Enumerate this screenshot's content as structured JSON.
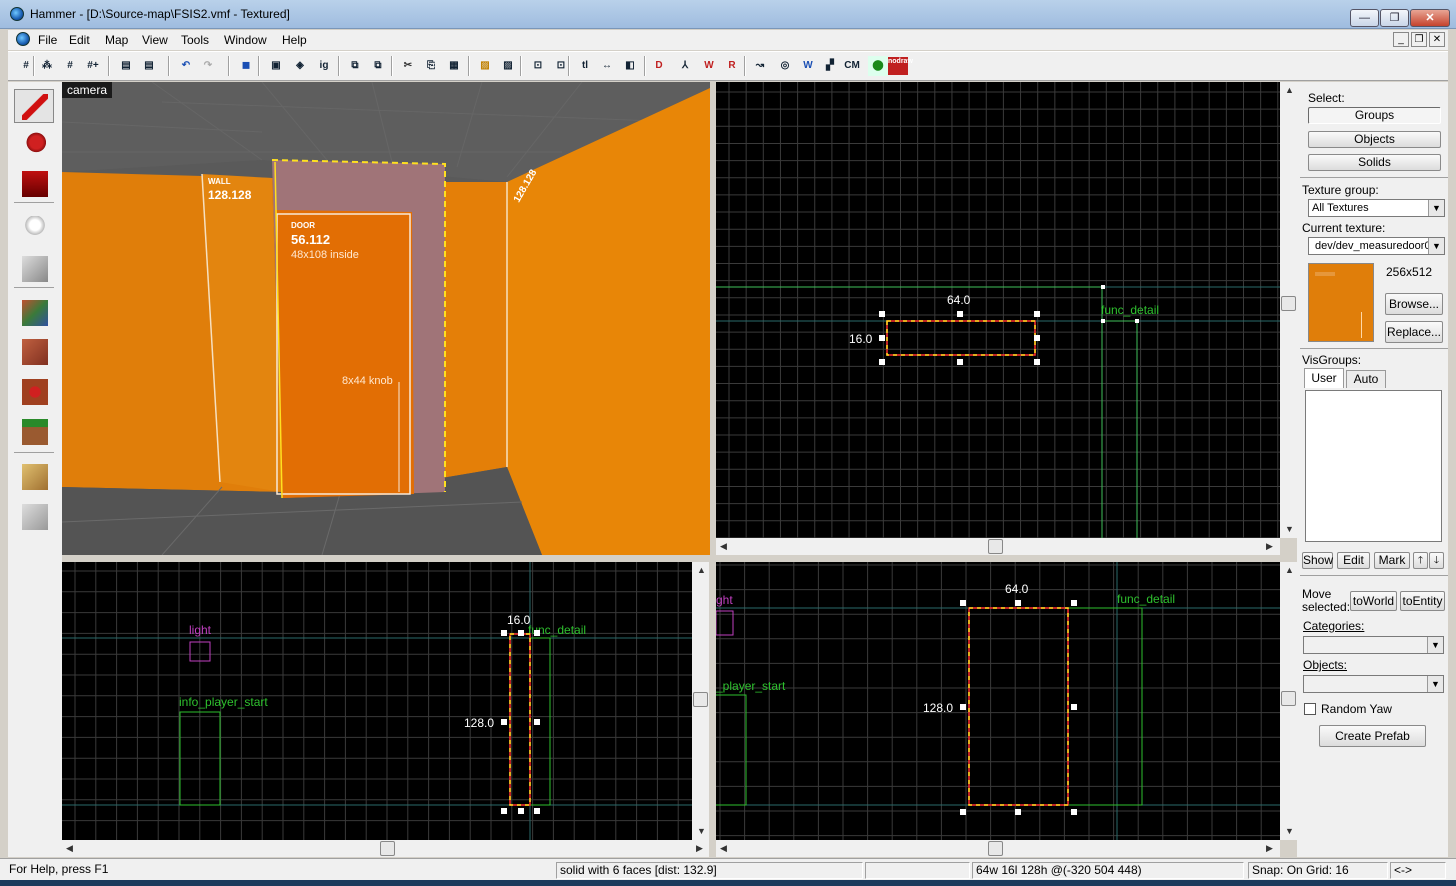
{
  "window": {
    "title": "Hammer - [D:\\Source-map\\FSIS2.vmf - Textured]",
    "minimize": "—",
    "restore": "❐",
    "close": "✕"
  },
  "menu": {
    "items": [
      "File",
      "Edit",
      "Map",
      "View",
      "Tools",
      "Window",
      "Help"
    ],
    "mdi_min": "_",
    "mdi_restore": "❐",
    "mdi_close": "✕"
  },
  "toolbar": {
    "buttons": [
      "#",
      "⁂",
      "#",
      "#+",
      "▤",
      "▤",
      "↶",
      "↷",
      "◼",
      "▣",
      "◈",
      "ig",
      "⧉",
      "⧉",
      "✂",
      "⎘",
      "▦",
      "▨",
      "▨",
      "⊡",
      "⊡",
      "tl",
      "↔",
      "◧",
      "D",
      "⅄",
      "W",
      "R",
      "↝",
      "◎",
      "W",
      "▞",
      "CM",
      "⬤",
      "nodraw"
    ]
  },
  "tools": {
    "selected_index": 0,
    "items": [
      "selection-tool",
      "magnify-tool",
      "camera-tool",
      "entity-tool",
      "block-tool",
      "texture-tool",
      "apply-texture-tool",
      "decal-tool",
      "overlay-tool",
      "clip-tool",
      "vertex-tool"
    ]
  },
  "camera_view": {
    "label": "camera",
    "wall_sign": {
      "line1": "WALL",
      "line2": "128.128"
    },
    "door_sign": {
      "line1": "DOOR",
      "line2": "56.112",
      "line3": "48x108 inside"
    },
    "knob_sign": "8x44 knob"
  },
  "top_view": {
    "width_label": "64.0",
    "depth_label": "16.0",
    "entity_label": "func_detail"
  },
  "front_view": {
    "width_label": "16.0",
    "height_label": "128.0",
    "entities": [
      "light",
      "info_player_start",
      "func_detail"
    ]
  },
  "side_view": {
    "width_label": "64.0",
    "height_label": "128.0",
    "entities": [
      "ght",
      "_player_start",
      "func_detail"
    ]
  },
  "panel": {
    "select_label": "Select:",
    "select_buttons": [
      "Groups",
      "Objects",
      "Solids"
    ],
    "selected_mode": "Groups",
    "texture_group_label": "Texture group:",
    "texture_group_value": "All Textures",
    "current_texture_label": "Current texture:",
    "current_texture_value": "dev/dev_measuredoor0",
    "texture_size": "256x512",
    "browse": "Browse...",
    "replace": "Replace...",
    "visgroups_label": "VisGroups:",
    "visgroup_tabs": [
      "User",
      "Auto"
    ],
    "show": "Show",
    "edit": "Edit",
    "mark": "Mark",
    "up_arrow": "🡑",
    "down_arrow": "🡓",
    "move_selected": "Move selected:",
    "to_world": "toWorld",
    "to_entity": "toEntity",
    "categories_label": "Categories:",
    "objects_label": "Objects:",
    "random_yaw": "Random Yaw",
    "random_yaw_checked": false,
    "create_prefab": "Create Prefab"
  },
  "status": {
    "help": "For Help, press F1",
    "selection": "solid with 6 faces   [dist: 132.9]",
    "size": "64w 16l 128h @(-320 504 448)",
    "snap": "Snap: On Grid: 16",
    "extra": "<->"
  },
  "colors": {
    "orange": "#e07e0a",
    "wireframe_select": "#ff3030",
    "selection_dashes": "#ffe020",
    "entity_green": "#2ec02e",
    "entity_magenta": "#c040c0",
    "grid": "#3a3a3a",
    "grid_axis": "#2a6a6a"
  }
}
